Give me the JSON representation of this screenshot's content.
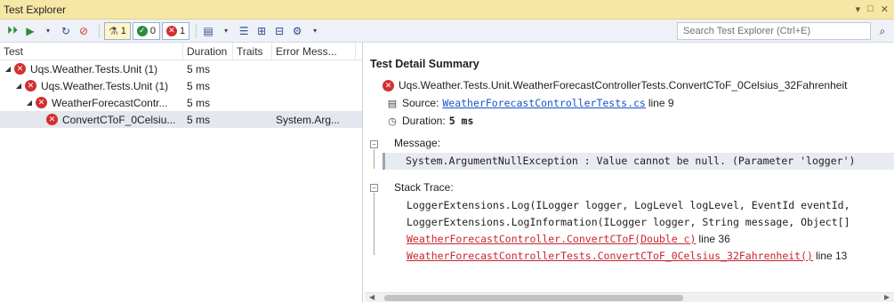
{
  "window": {
    "title": "Test Explorer",
    "controls": [
      "▾",
      "□",
      "✕"
    ]
  },
  "toolbar": {
    "run_all_icon": "run-all-icon",
    "run_icon": "run-icon",
    "filter_total": "1",
    "filter_passed": "0",
    "filter_failed": "1",
    "search_placeholder": "Search Test Explorer (Ctrl+E)"
  },
  "columns": {
    "test": "Test",
    "duration": "Duration",
    "traits": "Traits",
    "error": "Error Mess..."
  },
  "tree": [
    {
      "name": "Uqs.Weather.Tests.Unit (1)",
      "duration": "5 ms",
      "error": "",
      "level": 0,
      "caret": true
    },
    {
      "name": "Uqs.Weather.Tests.Unit (1)",
      "duration": "5 ms",
      "error": "",
      "level": 1,
      "caret": true
    },
    {
      "name": "WeatherForecastContr...",
      "duration": "5 ms",
      "error": "",
      "level": 2,
      "caret": true
    },
    {
      "name": "ConvertCToF_0Celsiu...",
      "duration": "5 ms",
      "error": "System.Arg...",
      "level": 3,
      "caret": false
    }
  ],
  "detail": {
    "heading": "Test Detail Summary",
    "full_name": "Uqs.Weather.Tests.Unit.WeatherForecastControllerTests.ConvertCToF_0Celsius_32Fahrenheit",
    "source_label": "Source:",
    "source_file": "WeatherForecastControllerTests.cs",
    "source_line": "line 9",
    "duration_label": "Duration:",
    "duration_value": "5 ms",
    "message_label": "Message:",
    "message_text": "System.ArgumentNullException : Value cannot be null. (Parameter 'logger')",
    "stack_label": "Stack Trace:",
    "stack": [
      {
        "text": "LoggerExtensions.Log(ILogger logger, LogLevel logLevel, EventId eventId,",
        "line": "",
        "link": false
      },
      {
        "text": "LoggerExtensions.LogInformation(ILogger logger, String message, Object[]",
        "line": "",
        "link": false
      },
      {
        "text": "WeatherForecastController.ConvertCToF(Double c)",
        "line": "line 36",
        "link": true
      },
      {
        "text": "WeatherForecastControllerTests.ConvertCToF_0Celsius_32Fahrenheit()",
        "line": "line 13",
        "link": true
      }
    ]
  },
  "colors": {
    "titlebar": "#f6e7a6",
    "fail": "#d32f2f",
    "pass": "#2e8b3a",
    "link": "#1a52c9",
    "stack_link": "#c7262e"
  }
}
